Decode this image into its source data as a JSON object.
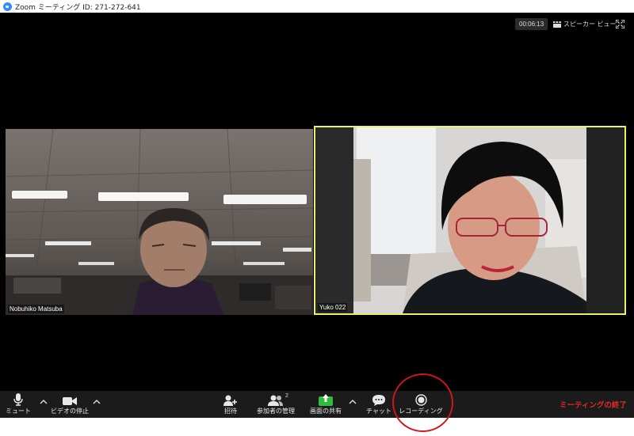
{
  "window": {
    "title": "Zoom ミーティング ID: 271-272-641"
  },
  "meeting": {
    "timer": "00:06:13",
    "view_label": "スピーカー ビュー"
  },
  "participants": [
    {
      "name": "Nobuhiko Matsuba",
      "active_speaker": false
    },
    {
      "name": "Yuko 022",
      "active_speaker": true
    }
  ],
  "toolbar": {
    "mute_label": "ミュート",
    "video_label": "ビデオの停止",
    "invite_label": "招待",
    "participants_label": "参加者の管理",
    "participants_count": "2",
    "share_label": "画面の共有",
    "chat_label": "チャット",
    "record_label": "レコーディング",
    "end_label": "ミーティングの終了"
  },
  "colors": {
    "active_speaker_border": "#e9f06f",
    "share_green": "#2fbd3b",
    "end_red": "#e22a2a",
    "annotation_red": "#d0161b"
  },
  "icons": {
    "mute": "microphone-icon",
    "video": "video-camera-icon",
    "invite": "add-person-icon",
    "participants": "people-icon",
    "share": "share-screen-icon",
    "chat": "chat-bubble-icon",
    "record": "record-icon",
    "fullscreen": "fullscreen-icon",
    "view": "speaker-view-icon"
  }
}
